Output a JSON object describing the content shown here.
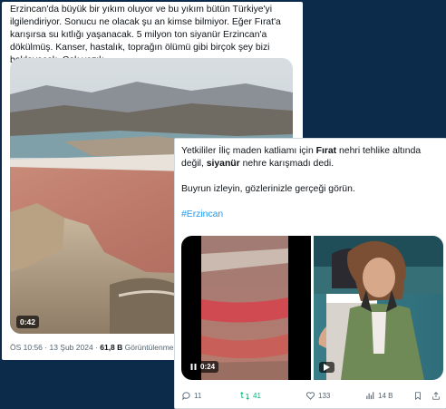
{
  "tweet1": {
    "text": "Erzincan'da büyük bir yıkım oluyor ve bu yıkım bütün Türkiye'yi ilgilendiriyor. Sonucu ne olacak şu an kimse bilmiyor. Eğer Fırat'a karışırsa su kıtlığı yaşanacak. 5 milyon ton siyanür Erzincan'a dökülmüş. Kanser, hastalık, toprağın ölümü gibi birçok şey bizi bekleyecek. Çok yazık.",
    "video_duration": "0:42",
    "timestamp": "ÖS 10:56 · 13 Şub 2024 · ",
    "views_count": "61,8 B",
    "views_label": " Görüntülenme"
  },
  "tweet2": {
    "line1_a": "Yetkililer İliç maden katliamı için ",
    "line1_b": "Fırat",
    "line1_c": " nehri tehlike altında değil, ",
    "line1_d": "siyanür",
    "line1_e": " nehre karışmadı dedi.",
    "line2": "Buyrun izleyin, gözlerinizle gerçeği görün.",
    "hashtag": "#Erzincan",
    "video_duration": "0:24",
    "actions": {
      "replies": "11",
      "retweets": "41",
      "likes": "133",
      "views": "14 B"
    }
  },
  "colors": {
    "background": "#0c2a4a",
    "hashtag": "#1d9bf0",
    "retweet": "#00ba7c",
    "muted": "#536471"
  },
  "icons": [
    "play-icon",
    "reply-icon",
    "retweet-icon",
    "like-icon",
    "views-icon",
    "bookmark-icon",
    "share-icon"
  ]
}
